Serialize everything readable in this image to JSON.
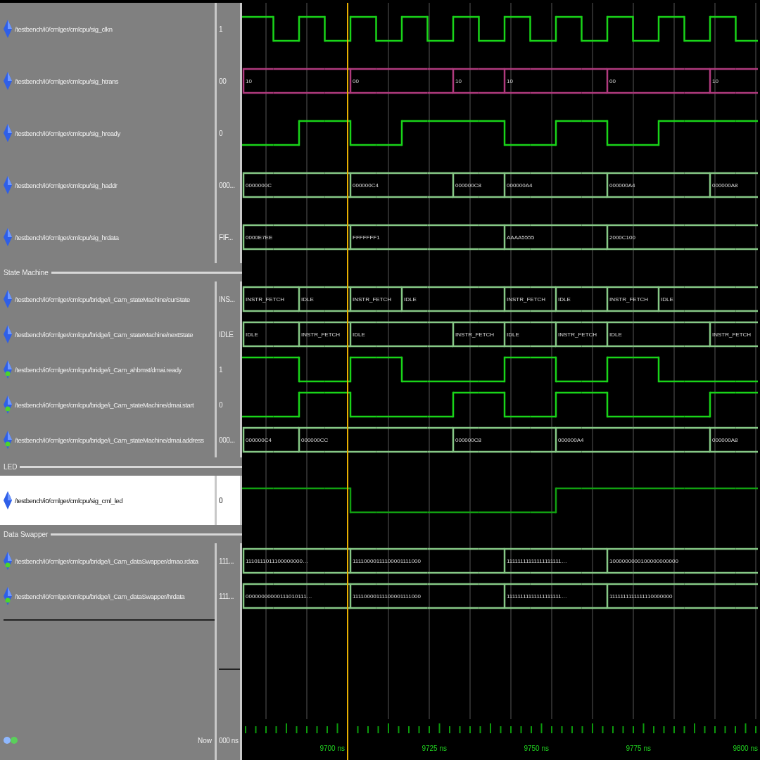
{
  "groups": [
    {
      "signals": [
        {
          "name": "/testbench/i0/cmlger/cmlcpu/sig_clkn",
          "value": "1",
          "kind": "bit",
          "port": false,
          "selected": false,
          "color": "#19d419",
          "levels": [
            true,
            false,
            true,
            false,
            true,
            false,
            true,
            false,
            true,
            false,
            true,
            false,
            true,
            false,
            true,
            false,
            true,
            false,
            true,
            false
          ]
        },
        {
          "name": "/testbench/i0/cmlger/cmlcpu/sig_htrans",
          "value": "00",
          "kind": "bus",
          "port": false,
          "selected": false,
          "color": "#b03a7e",
          "changes": [
            true,
            false,
            false,
            false,
            true,
            false,
            false,
            false,
            true,
            false,
            true,
            false,
            false,
            false,
            true,
            false,
            false,
            false,
            true,
            false
          ],
          "labels": [
            "10",
            "00",
            "10",
            "10",
            "00",
            "10"
          ]
        },
        {
          "name": "/testbench/i0/cmlger/cmlcpu/sig_hready",
          "value": "0",
          "kind": "bit",
          "port": false,
          "selected": false,
          "color": "#19d419",
          "levels": [
            false,
            false,
            true,
            true,
            false,
            false,
            true,
            true,
            true,
            true,
            false,
            false,
            true,
            true,
            false,
            false,
            true,
            true,
            true,
            true
          ]
        },
        {
          "name": "/testbench/i0/cmlger/cmlcpu/sig_haddr",
          "value": "000...",
          "kind": "bus",
          "port": false,
          "selected": false,
          "color": "#86c886",
          "changes": [
            true,
            false,
            false,
            false,
            true,
            false,
            false,
            false,
            true,
            false,
            true,
            false,
            false,
            false,
            true,
            false,
            false,
            false,
            true,
            false
          ],
          "labels": [
            "0000000C",
            "000000C4",
            "000000C8",
            "000000A4",
            "000000A4",
            "000000A8"
          ]
        },
        {
          "name": "/testbench/i0/cmlger/cmlcpu/sig_hrdata",
          "value": "FIF...",
          "kind": "bus",
          "port": false,
          "selected": false,
          "color": "#86c886",
          "changes": [
            true,
            false,
            false,
            false,
            true,
            false,
            false,
            false,
            false,
            false,
            true,
            false,
            false,
            false,
            true,
            false,
            false,
            false,
            false,
            false
          ],
          "labels": [
            "0000E7EE",
            "FFFFFFF1",
            "AAAA5555",
            "2000C100"
          ]
        }
      ]
    },
    {
      "title": "State Machine",
      "signals": [
        {
          "name": "/testbench/i0/cmlger/cmlcpu/bridge/i_Cam_stateMachine/curState",
          "value": "INS...",
          "kind": "bus",
          "port": false,
          "selected": false,
          "color": "#86c886",
          "changes": [
            true,
            false,
            true,
            false,
            true,
            false,
            true,
            false,
            false,
            false,
            true,
            false,
            true,
            false,
            true,
            false,
            true,
            false,
            false,
            false
          ],
          "labels": [
            "INSTR_FETCH",
            "IDLE",
            "INSTR_FETCH",
            "IDLE",
            "INSTR_FETCH",
            "IDLE",
            "INSTR_FETCH",
            "IDLE"
          ]
        },
        {
          "name": "/testbench/i0/cmlger/cmlcpu/bridge/i_Cam_stateMachine/nextState",
          "value": "IDLE",
          "kind": "bus",
          "port": false,
          "selected": false,
          "color": "#86c886",
          "changes": [
            true,
            false,
            true,
            false,
            true,
            false,
            false,
            false,
            true,
            false,
            true,
            false,
            true,
            false,
            true,
            false,
            false,
            false,
            true,
            false
          ],
          "labels": [
            "IDLE",
            "INSTR_FETCH",
            "IDLE",
            "INSTR_FETCH",
            "IDLE",
            "INSTR_FETCH",
            "IDLE",
            "INSTR_FETCH"
          ]
        },
        {
          "name": "/testbench/i0/cmlger/cmlcpu/bridge/i_Cam_ahbmst/dmai.ready",
          "value": "1",
          "kind": "bit",
          "port": true,
          "selected": false,
          "color": "#19d419",
          "levels": [
            true,
            true,
            false,
            false,
            true,
            true,
            false,
            false,
            false,
            false,
            true,
            true,
            false,
            false,
            true,
            true,
            false,
            false,
            false,
            false
          ]
        },
        {
          "name": "/testbench/i0/cmlger/cmlcpu/bridge/i_Cam_stateMachine/dmai.start",
          "value": "0",
          "kind": "bit",
          "port": true,
          "selected": false,
          "color": "#19d419",
          "levels": [
            false,
            false,
            true,
            true,
            false,
            false,
            false,
            false,
            true,
            true,
            false,
            false,
            true,
            true,
            false,
            false,
            false,
            false,
            true,
            true
          ]
        },
        {
          "name": "/testbench/i0/cmlger/cmlcpu/bridge/i_Cam_stateMachine/dmai.address",
          "value": "000...",
          "kind": "bus",
          "port": true,
          "selected": false,
          "color": "#86c886",
          "changes": [
            true,
            false,
            true,
            false,
            false,
            false,
            false,
            false,
            true,
            false,
            false,
            false,
            true,
            false,
            false,
            false,
            false,
            false,
            true,
            false
          ],
          "labels": [
            "000000C4",
            "000000CC",
            "000000C8",
            "000000A4",
            "000000A8"
          ]
        }
      ]
    },
    {
      "title": "LED",
      "signals": [
        {
          "name": "/testbench/i0/cmlger/cmlcpu/sig_cml_led",
          "value": "0",
          "kind": "bit",
          "port": false,
          "selected": true,
          "color": "#11a011",
          "levels": [
            true,
            true,
            true,
            true,
            false,
            false,
            false,
            false,
            false,
            false,
            false,
            false,
            true,
            true,
            true,
            true,
            true,
            true,
            true,
            true
          ]
        }
      ]
    },
    {
      "title": "Data Swapper",
      "signals": [
        {
          "name": "/testbench/i0/cmlger/cmlcpu/bridge/i_Cam_dataSwapper/dmao.rdata",
          "value": "111...",
          "kind": "bus",
          "port": true,
          "selected": false,
          "color": "#86c886",
          "changes": [
            true,
            false,
            false,
            false,
            true,
            false,
            false,
            false,
            false,
            false,
            true,
            false,
            false,
            false,
            true,
            false,
            false,
            false,
            false,
            false
          ],
          "labels": [
            "1110111011100000000…",
            "11110000111100001111000",
            "11111111111111111111…",
            "1000000000100000000000"
          ]
        },
        {
          "name": "/testbench/i0/cmlger/cmlcpu/bridge/i_Cam_dataSwapper/hrdata",
          "value": "111...",
          "kind": "bus",
          "port": true,
          "selected": false,
          "color": "#86c886",
          "changes": [
            true,
            false,
            false,
            false,
            true,
            false,
            false,
            false,
            false,
            false,
            true,
            false,
            false,
            false,
            true,
            false,
            false,
            false,
            false,
            false
          ],
          "labels": [
            "00000000000111010111…",
            "11110000111100001111000",
            "11111111111111111111…",
            "1111111111111110000000"
          ]
        }
      ]
    }
  ],
  "status": {
    "now_label": "Now",
    "now_value": "000 ns"
  },
  "timeline": {
    "ticks": [
      "9700 ns",
      "9725 ns",
      "9750 ns",
      "9775 ns",
      "9800 ns"
    ]
  }
}
